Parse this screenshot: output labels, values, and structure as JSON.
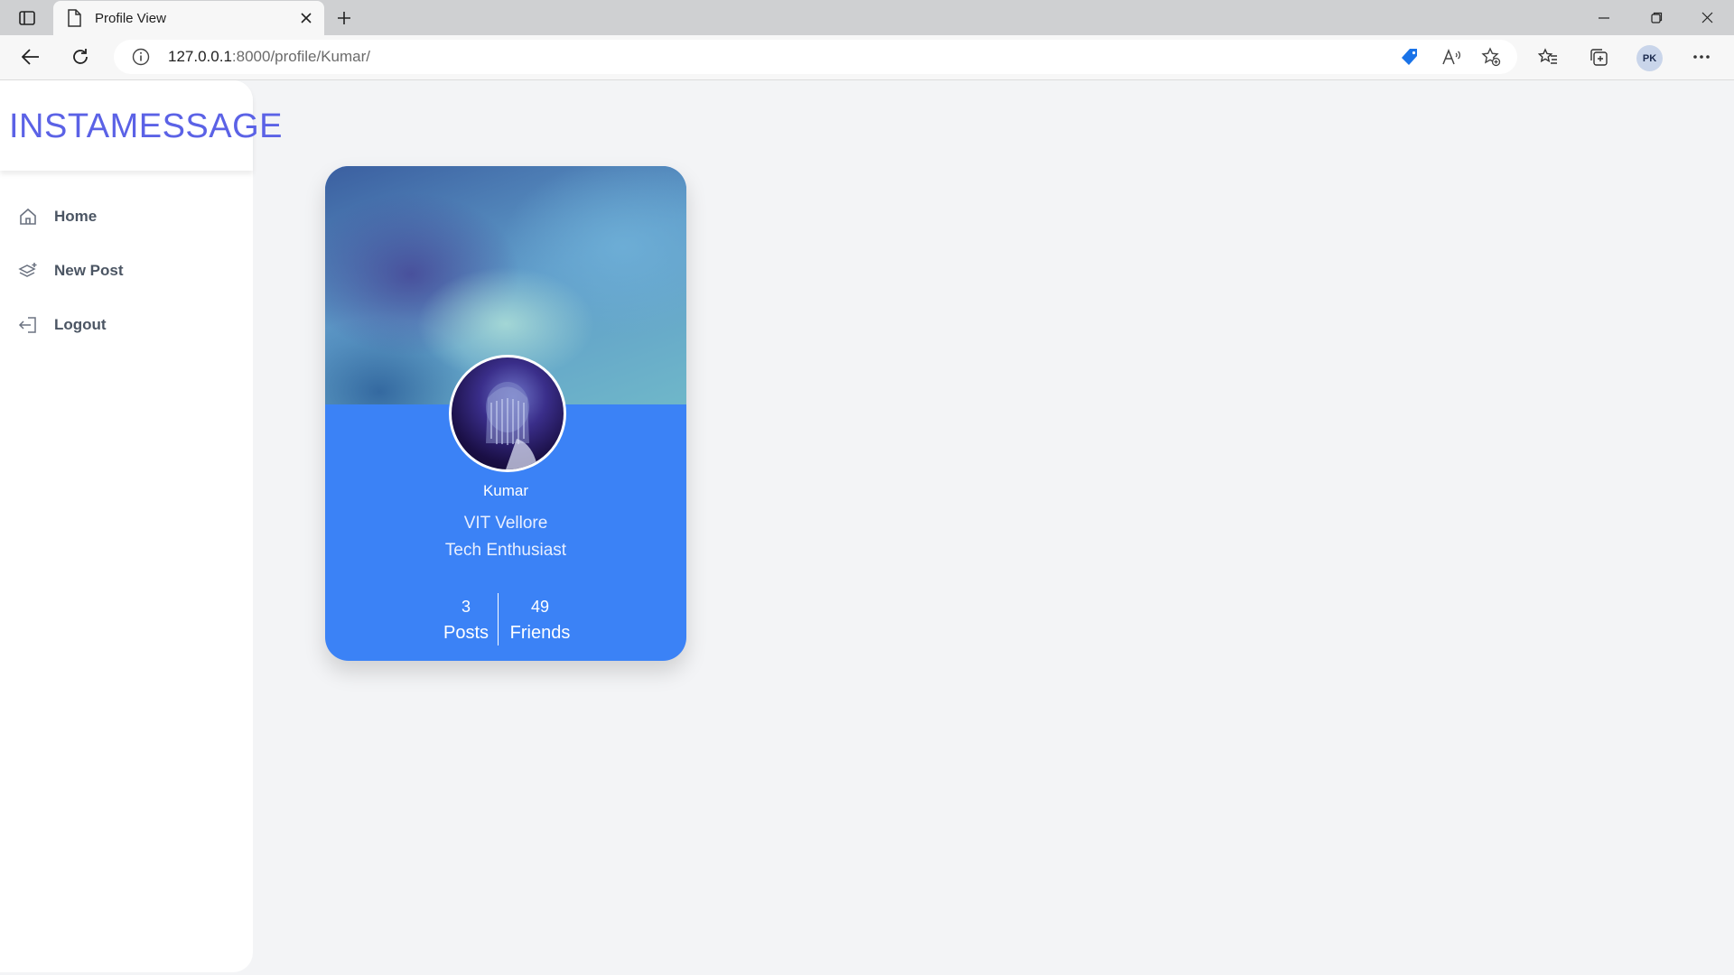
{
  "browser": {
    "tab_title": "Profile View",
    "url_host": "127.0.0.1",
    "url_rest": ":8000/profile/Kumar/",
    "profile_initials": "PK"
  },
  "sidebar": {
    "brand": "INSTAMESSAGE",
    "items": [
      {
        "label": "Home",
        "icon": "home-icon"
      },
      {
        "label": "New Post",
        "icon": "layers-plus-icon"
      },
      {
        "label": "Logout",
        "icon": "logout-icon"
      }
    ]
  },
  "profile": {
    "name": "Kumar",
    "line1": "VIT Vellore",
    "line2": "Tech Enthusiast",
    "posts_count": "3",
    "posts_label": "Posts",
    "friends_count": "49",
    "friends_label": "Friends"
  },
  "colors": {
    "brand": "#5b62e6",
    "card": "#3b82f6",
    "page_bg": "#f3f4f6"
  }
}
